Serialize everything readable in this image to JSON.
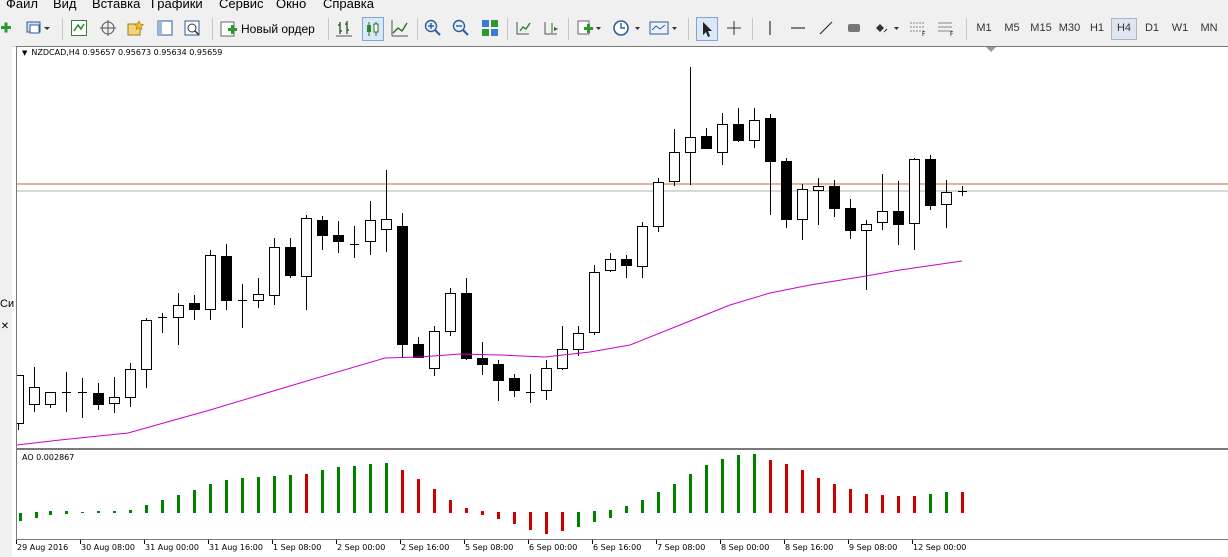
{
  "menu": {
    "items": [
      "Файл",
      "Вид",
      "Вставка",
      "Графики",
      "Сервис",
      "Окно",
      "Справка"
    ]
  },
  "toolbar": {
    "new_order_label": "Новый ордер",
    "timeframes": [
      "M1",
      "M5",
      "M15",
      "M30",
      "H1",
      "H4",
      "D1",
      "W1",
      "MN"
    ],
    "active_timeframe": "H4"
  },
  "left_panel": {
    "fragment_text": "Си"
  },
  "chart": {
    "header": "NZDCAD,H4  0.95657 0.95673 0.95634 0.95659",
    "colors": {
      "bull_body": "#ffffff",
      "bear_body": "#000000",
      "ma_line": "#cc00cc",
      "price_line": "#cc6633",
      "ao_up": "#008000",
      "ao_down": "#cc0000"
    }
  },
  "indicator": {
    "label": "AO 0.002867"
  },
  "xaxis": {
    "labels": [
      "29 Aug 2016",
      "30 Aug 08:00",
      "31 Aug 00:00",
      "31 Aug 16:00",
      "1 Sep 08:00",
      "2 Sep 00:00",
      "2 Sep 16:00",
      "5 Sep 08:00",
      "6 Sep 00:00",
      "6 Sep 16:00",
      "7 Sep 08:00",
      "8 Sep 00:00",
      "8 Sep 16:00",
      "9 Sep 08:00",
      "12 Sep 00:00"
    ]
  },
  "chart_data": {
    "type": "candlestick",
    "symbol": "NZDCAD",
    "timeframe": "H4",
    "last_ohlc": {
      "open": 0.95657,
      "high": 0.95673,
      "low": 0.95634,
      "close": 0.95659
    },
    "indicator": {
      "name": "AO",
      "value": 0.002867
    }
  }
}
